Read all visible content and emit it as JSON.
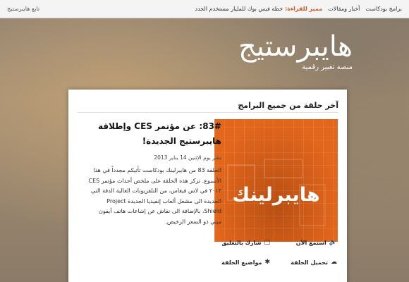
{
  "topbar": {
    "nav": [
      "برامج بودكاست",
      "أخبار ومقالات"
    ],
    "featured_label": "مميز للقراءة:",
    "featured_text": "خطة فيس بوك للمليار مستخدم الجدد",
    "follow": "تابع هايبرستيج"
  },
  "brand": {
    "logo": "هايبرستيج",
    "tagline": "منصة تعبير رقمية"
  },
  "section": {
    "title": "آخر حلقة من جميع البرامج"
  },
  "thumbnail": {
    "text": "هايبرلينك",
    "color": "#e2661c"
  },
  "post": {
    "title": "83#: عن مؤتمر CES وإطلاقة هايبرستيج الجديدة!",
    "date": "نشر يوم الإثنين 14 يناير 2013",
    "body": "الحلقة 83 من هايبرلينك بودكاست تأتيكم مجدداً في هذا الأسبوع. تركز هذه الحلقة على ملخص أحداث مؤتمر CES ٢٠١٣ في لاس فيغاس، من التلفزيونات العالية الدقة التي الجديدة الى مشغل ألعاب إنفيديا الجديدة Project Shield، بالإضافة الى نقاش عن إشاعات هاتف آيفون ميني ذو السعر الرخيص."
  },
  "actions": {
    "listen": {
      "label": "استمع الآن",
      "icon": "speaker-icon"
    },
    "comment": {
      "label": "شارك بالتعليق",
      "icon": "speech-bubble-icon"
    },
    "download": {
      "label": "تحميل الحلقة",
      "icon": "cloud-download-icon"
    },
    "topics": {
      "label": "مواضيع الحلقة",
      "icon": "asterisk-icon"
    }
  }
}
